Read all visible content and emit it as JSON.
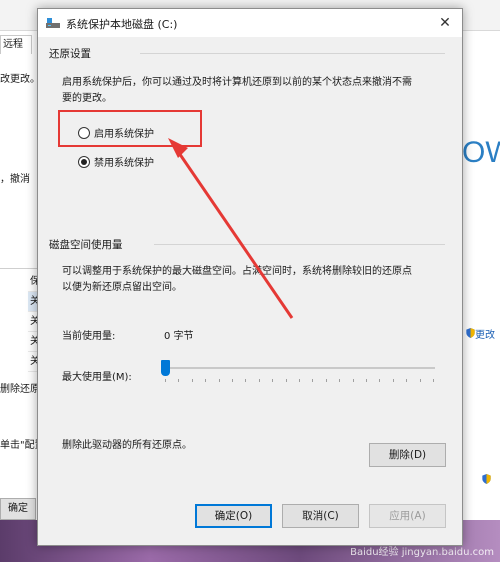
{
  "background": {
    "tab_label": "远程",
    "texts": [
      "改更改。",
      "，撤消",
      "删除还原点",
      "单击\"配置",
      "保",
      "关",
      "关",
      "关",
      "关"
    ],
    "right_big_text": "OW",
    "right_link_1": "更改",
    "bottom_button": "确定",
    "watermark": "Baidu经验 jingyan.baidu.com"
  },
  "dialog": {
    "title": "系统保护本地磁盘 (C:)",
    "close_glyph": "✕",
    "restore_settings": {
      "header": "还原设置",
      "description_line1": "启用系统保护后，你可以通过及时将计算机还原到以前的某个状态点来撤消不需",
      "description_line2": "要的更改。",
      "options": [
        {
          "label": "启用系统保护",
          "selected": false
        },
        {
          "label": "禁用系统保护",
          "selected": true
        }
      ]
    },
    "disk_usage": {
      "header": "磁盘空间使用量",
      "description_line1": "可以调整用于系统保护的最大磁盘空间。占满空间时，系统将删除较旧的还原点",
      "description_line2": "以便为新还原点留出空间。",
      "current_label": "当前使用量:",
      "current_value": "0 字节",
      "max_label": "最大使用量(M):",
      "max_value_fraction": 0.0
    },
    "delete_text": "删除此驱动器的所有还原点。",
    "delete_button": "删除(D)",
    "ok_button": "确定(O)",
    "cancel_button": "取消(C)",
    "apply_button": "应用(A)"
  },
  "colors": {
    "accent": "#0078d7",
    "highlight": "#e53935"
  }
}
